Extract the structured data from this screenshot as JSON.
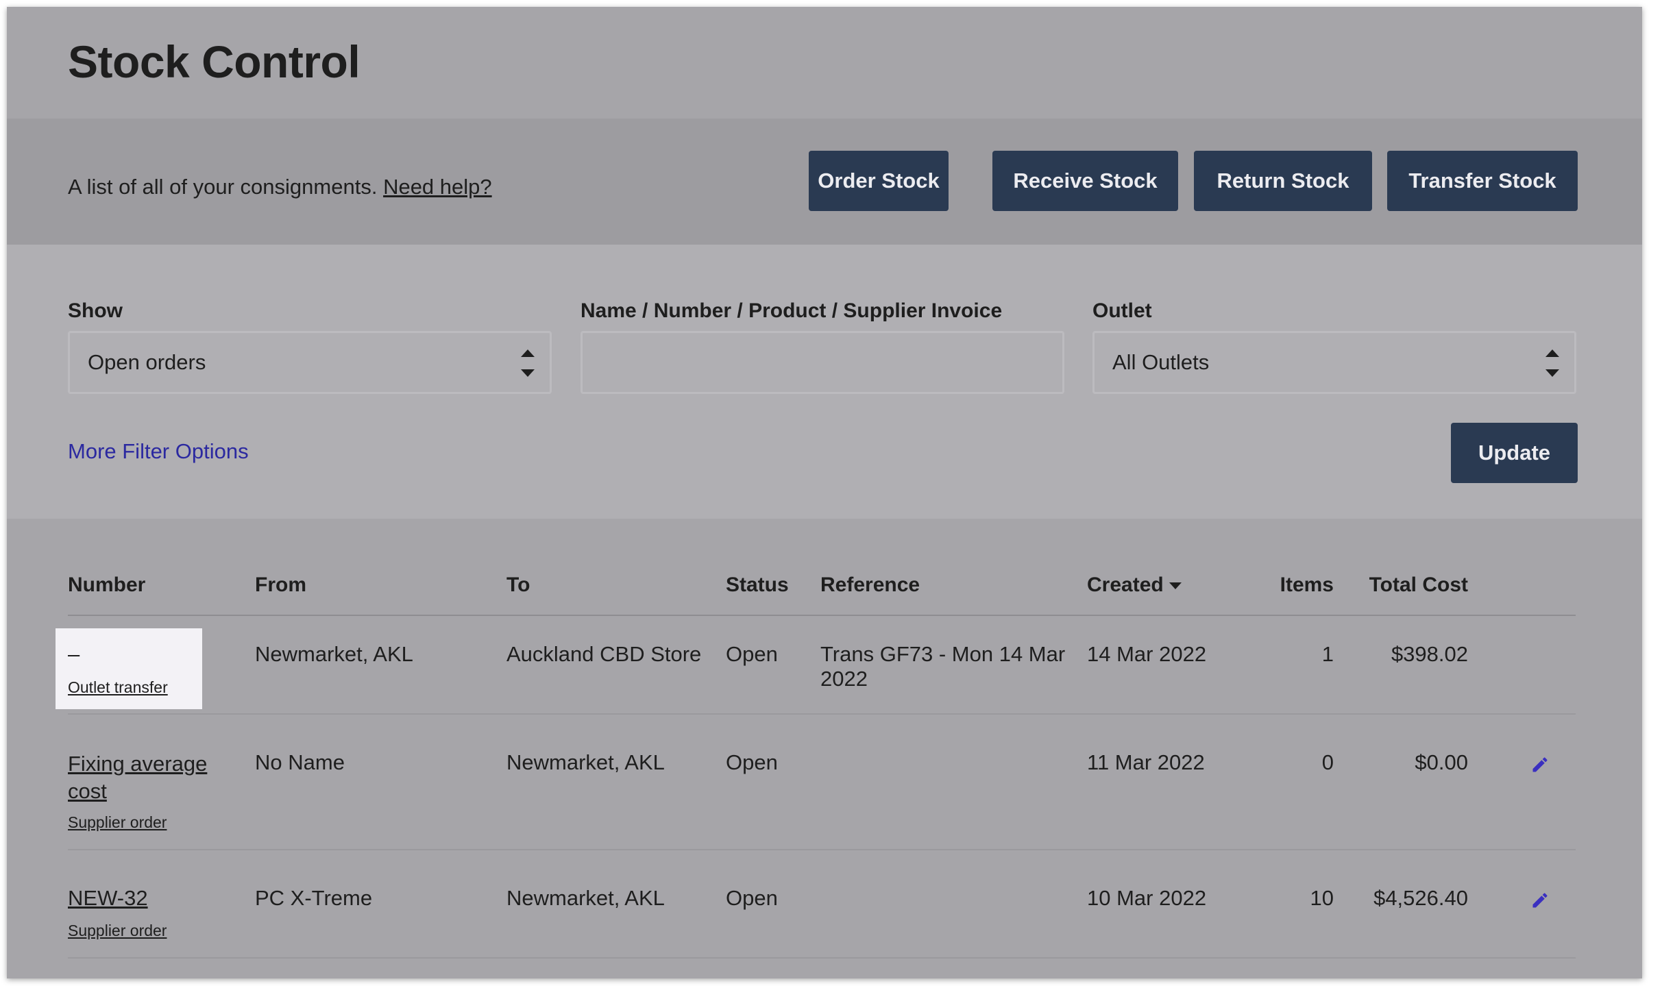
{
  "header": {
    "title": "Stock Control"
  },
  "actions": {
    "description": "A list of all of your consignments.",
    "help_link": "Need help?",
    "buttons": [
      "Order Stock",
      "Receive Stock",
      "Return Stock",
      "Transfer Stock"
    ]
  },
  "filters": {
    "show_label": "Show",
    "show_value": "Open orders",
    "search_label": "Name / Number / Product / Supplier Invoice",
    "search_value": "",
    "outlet_label": "Outlet",
    "outlet_value": "All Outlets",
    "more_options": "More Filter Options",
    "update_button": "Update"
  },
  "table": {
    "headers": [
      "Number",
      "From",
      "To",
      "Status",
      "Reference",
      "Created",
      "Items",
      "Total Cost"
    ],
    "sort_column": "Created",
    "rows": [
      {
        "number": "–",
        "type": "Outlet transfer",
        "from": "Newmarket, AKL",
        "to": "Auckland CBD Store",
        "status": "Open",
        "reference_line1": "Trans GF73 - Mon 14 Mar",
        "reference_line2": "2022",
        "created": "14 Mar 2022",
        "items": "1",
        "total": "$398.02",
        "editable": false
      },
      {
        "number_line1": "Fixing average",
        "number_line2": "cost",
        "type": "Supplier order",
        "from": "No Name",
        "to": "Newmarket, AKL",
        "status": "Open",
        "reference": "",
        "created": "11 Mar 2022",
        "items": "0",
        "total": "$0.00",
        "editable": true
      },
      {
        "number": "NEW-32",
        "type": "Supplier order",
        "from": "PC X-Treme",
        "to": "Newmarket, AKL",
        "status": "Open",
        "reference": "",
        "created": "10 Mar 2022",
        "items": "10",
        "total": "$4,526.40",
        "editable": true
      }
    ]
  },
  "icons": {
    "edit": "pencil-icon",
    "sort": "caret-down-icon",
    "select": "spinner-arrows-icon"
  },
  "colors": {
    "button": "#2a3a52",
    "link": "#2b29a0",
    "edit_icon": "#3a2fc0",
    "highlight_row": "#f3f2f6"
  }
}
